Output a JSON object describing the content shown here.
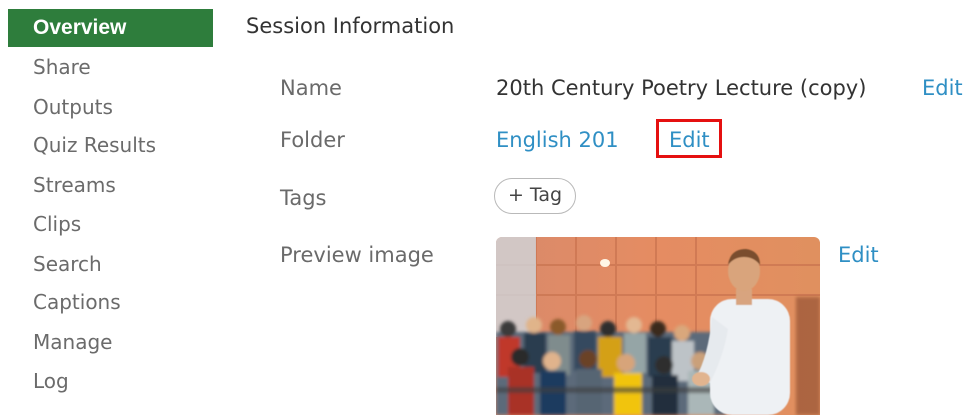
{
  "sidebar": {
    "items": [
      {
        "label": "Overview",
        "active": true
      },
      {
        "label": "Share"
      },
      {
        "label": "Outputs"
      },
      {
        "label": "Quiz Results"
      },
      {
        "label": "Streams"
      },
      {
        "label": "Clips"
      },
      {
        "label": "Search"
      },
      {
        "label": "Captions"
      },
      {
        "label": "Manage"
      },
      {
        "label": "Log"
      }
    ]
  },
  "main": {
    "section_title": "Session Information",
    "fields": {
      "name_label": "Name",
      "name_value": "20th Century Poetry Lecture (copy)",
      "name_edit": "Edit",
      "folder_label": "Folder",
      "folder_value": "English 201",
      "folder_edit": "Edit",
      "tags_label": "Tags",
      "tag_button": "+ Tag",
      "preview_label": "Preview image",
      "preview_edit": "Edit"
    }
  },
  "colors": {
    "active_nav_bg": "#2e7d3c",
    "link": "#2f8fc4",
    "highlight": "#e51010"
  },
  "icons": {
    "preview_image": "lecture-hall-photo"
  }
}
